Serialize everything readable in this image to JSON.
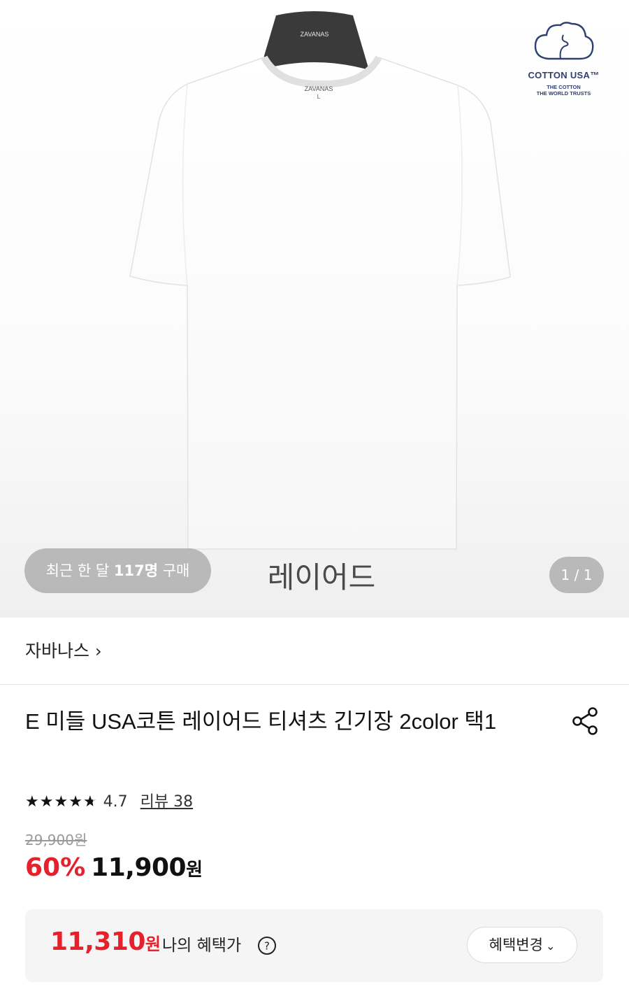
{
  "hero": {
    "hanger_brand": "ZAVANAS",
    "shirt_label_brand": "ZAVANAS",
    "shirt_label_size": "L",
    "cotton_logo": {
      "title": "COTTON USA™",
      "subtitle_1": "THE COTTON",
      "subtitle_2": "THE WORLD TRUSTS"
    },
    "buyers_prefix": "최근 한 달 ",
    "buyers_count": "117명",
    "buyers_suffix": " 구매",
    "caption": "레이어드",
    "image_counter": "1 / 1"
  },
  "brand": {
    "name": "자바나스",
    "chevron": "›"
  },
  "product": {
    "title": "E 미들 USA코튼 레이어드 티셔츠 긴기장 2color 택1",
    "rating_stars": 4.7,
    "rating_value": "4.7",
    "review_link": "리뷰 38",
    "original_price": "29,900원",
    "discount": "60%",
    "sale_price": "11,900",
    "sale_unit": "원"
  },
  "benefit": {
    "amount": "11,310",
    "unit": "원",
    "label": "나의 혜택가",
    "change_button": "혜택변경"
  },
  "colors": {
    "accent_red": "#e5212b",
    "pill_gray": "#969696",
    "benefit_bg": "#f5f5f5"
  },
  "icons": [
    "share-icon",
    "help-icon",
    "chevron-down-icon",
    "star-icon",
    "chevron-right-icon"
  ]
}
